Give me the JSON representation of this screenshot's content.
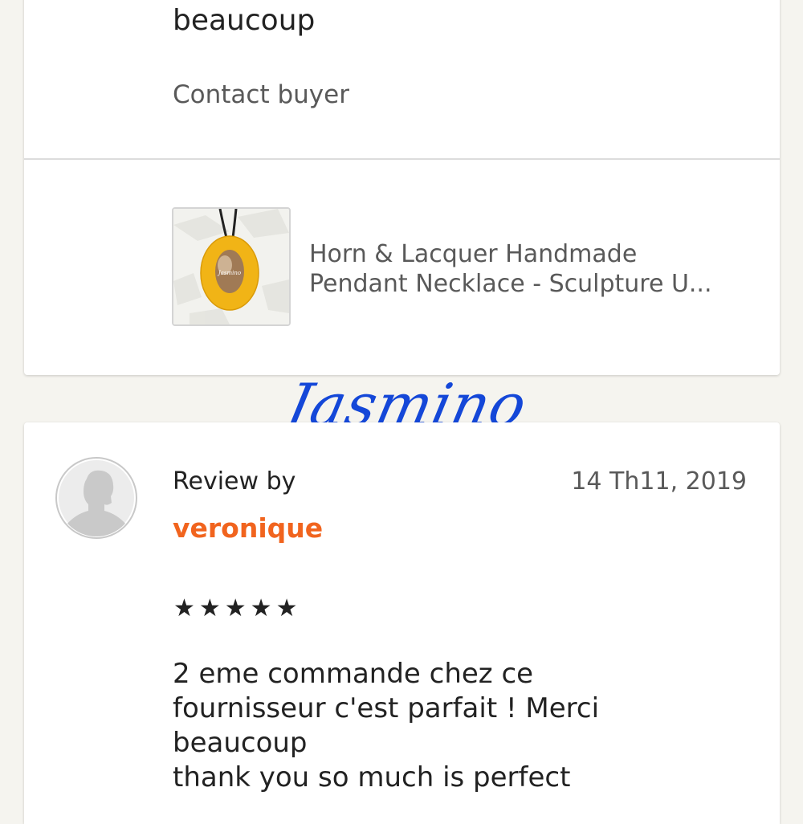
{
  "previous_review": {
    "text_tail": "beaucoup",
    "contact_buyer_label": "Contact buyer"
  },
  "product": {
    "title_line1": "Horn & Lacquer Handmade",
    "title_line2": "Pendant Necklace - Sculpture U...",
    "pendant_inscription": "Jasmino"
  },
  "watermark": "Jasmino",
  "review": {
    "label": "Review by",
    "date": "14 Th11, 2019",
    "reviewer": "veronique",
    "stars": "★★★★★",
    "rating": 5,
    "text": "2 eme  commande chez ce\nfournisseur c'est parfait ! Merci\nbeaucoup\nthank you so much is perfect"
  },
  "colors": {
    "background": "#f5f4ef",
    "card": "#ffffff",
    "reviewer_name": "#f1641e",
    "watermark": "#1447d8",
    "pendant": "#f1b416"
  },
  "icons": {
    "avatar": "default-user-avatar-icon",
    "star": "star-icon"
  }
}
